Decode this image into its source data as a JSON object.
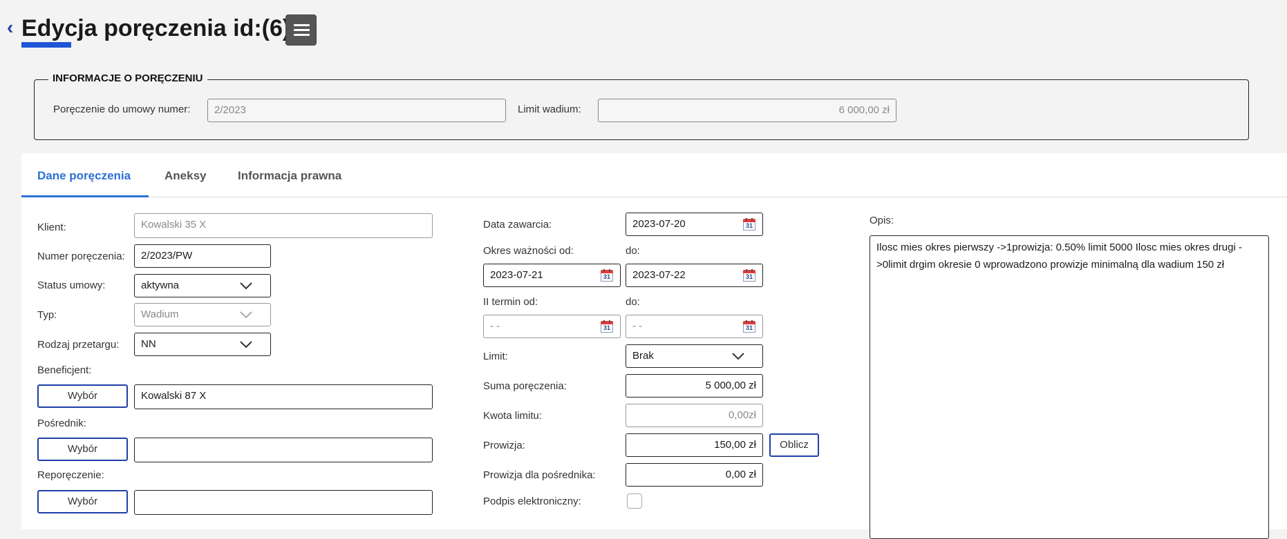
{
  "header": {
    "back_glyph": "‹",
    "title": "Edycja poręczenia id:(6)"
  },
  "info": {
    "legend": "INFORMACJE O PORĘCZENIU",
    "contract_label": "Poręczenie do umowy numer:",
    "contract_value": "2/2023",
    "limit_label": "Limit wadium:",
    "limit_value": "6 000,00 zł"
  },
  "tabs": [
    {
      "label": "Dane poręczenia",
      "active": true
    },
    {
      "label": "Aneksy",
      "active": false
    },
    {
      "label": "Informacja prawna",
      "active": false
    }
  ],
  "left": {
    "client_label": "Klient:",
    "client_value": "Kowalski 35 X",
    "number_label": "Numer poręczenia:",
    "number_value": "2/2023/PW",
    "status_label": "Status umowy:",
    "status_value": "aktywna",
    "type_label": "Typ:",
    "type_value": "Wadium",
    "tender_label": "Rodzaj przetargu:",
    "tender_value": "NN",
    "beneficiary_label": "Beneficjent:",
    "beneficiary_button": "Wybór",
    "beneficiary_value": "Kowalski 87 X",
    "intermediary_label": "Pośrednik:",
    "intermediary_button": "Wybór",
    "intermediary_value": "",
    "reguarantee_label": "Reporęczenie:",
    "reguarantee_button": "Wybór",
    "reguarantee_value": ""
  },
  "middle": {
    "date_label": "Data zawarcia:",
    "date_value": "2023-07-20",
    "validity_label": "Okres ważności od:",
    "to_label": "do:",
    "validity_from": "2023-07-21",
    "validity_to": "2023-07-22",
    "second_term_label": "II termin od:",
    "to_label2": "do:",
    "second_from": "- -",
    "second_to": "- -",
    "limit_label": "Limit:",
    "limit_value": "Brak",
    "sum_label": "Suma poręczenia:",
    "sum_value": "5 000,00 zł",
    "limit_amount_label": "Kwota limitu:",
    "limit_amount_value": "0,00zł",
    "commission_label": "Prowizja:",
    "commission_value": "150,00 zł",
    "calculate_button": "Oblicz",
    "intermediary_commission_label": "Prowizja dla pośrednika:",
    "intermediary_commission_value": "0,00 zł",
    "esign_label": "Podpis elektroniczny:",
    "calendar_day": "31"
  },
  "right": {
    "desc_label": "Opis:",
    "desc_value": "Ilosc mies okres pierwszy  ->1prowizja: 0.50% limit 5000 Ilosc mies okres drugi ->0limit drgim okresie 0 wprowadzono prowizje minimalną dla wadium 150 zł"
  }
}
